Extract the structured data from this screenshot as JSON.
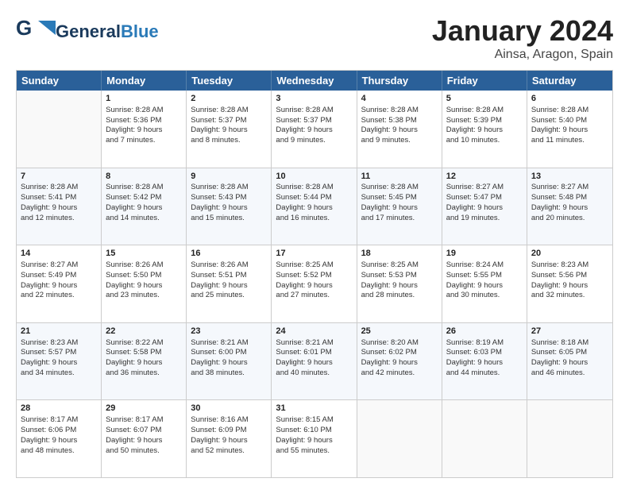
{
  "header": {
    "logo_line1": "General",
    "logo_line2": "Blue",
    "title": "January 2024",
    "subtitle": "Ainsa, Aragon, Spain"
  },
  "calendar": {
    "days": [
      "Sunday",
      "Monday",
      "Tuesday",
      "Wednesday",
      "Thursday",
      "Friday",
      "Saturday"
    ],
    "rows": [
      [
        {
          "num": "",
          "lines": []
        },
        {
          "num": "1",
          "lines": [
            "Sunrise: 8:28 AM",
            "Sunset: 5:36 PM",
            "Daylight: 9 hours",
            "and 7 minutes."
          ]
        },
        {
          "num": "2",
          "lines": [
            "Sunrise: 8:28 AM",
            "Sunset: 5:37 PM",
            "Daylight: 9 hours",
            "and 8 minutes."
          ]
        },
        {
          "num": "3",
          "lines": [
            "Sunrise: 8:28 AM",
            "Sunset: 5:37 PM",
            "Daylight: 9 hours",
            "and 9 minutes."
          ]
        },
        {
          "num": "4",
          "lines": [
            "Sunrise: 8:28 AM",
            "Sunset: 5:38 PM",
            "Daylight: 9 hours",
            "and 9 minutes."
          ]
        },
        {
          "num": "5",
          "lines": [
            "Sunrise: 8:28 AM",
            "Sunset: 5:39 PM",
            "Daylight: 9 hours",
            "and 10 minutes."
          ]
        },
        {
          "num": "6",
          "lines": [
            "Sunrise: 8:28 AM",
            "Sunset: 5:40 PM",
            "Daylight: 9 hours",
            "and 11 minutes."
          ]
        }
      ],
      [
        {
          "num": "7",
          "lines": [
            "Sunrise: 8:28 AM",
            "Sunset: 5:41 PM",
            "Daylight: 9 hours",
            "and 12 minutes."
          ]
        },
        {
          "num": "8",
          "lines": [
            "Sunrise: 8:28 AM",
            "Sunset: 5:42 PM",
            "Daylight: 9 hours",
            "and 14 minutes."
          ]
        },
        {
          "num": "9",
          "lines": [
            "Sunrise: 8:28 AM",
            "Sunset: 5:43 PM",
            "Daylight: 9 hours",
            "and 15 minutes."
          ]
        },
        {
          "num": "10",
          "lines": [
            "Sunrise: 8:28 AM",
            "Sunset: 5:44 PM",
            "Daylight: 9 hours",
            "and 16 minutes."
          ]
        },
        {
          "num": "11",
          "lines": [
            "Sunrise: 8:28 AM",
            "Sunset: 5:45 PM",
            "Daylight: 9 hours",
            "and 17 minutes."
          ]
        },
        {
          "num": "12",
          "lines": [
            "Sunrise: 8:27 AM",
            "Sunset: 5:47 PM",
            "Daylight: 9 hours",
            "and 19 minutes."
          ]
        },
        {
          "num": "13",
          "lines": [
            "Sunrise: 8:27 AM",
            "Sunset: 5:48 PM",
            "Daylight: 9 hours",
            "and 20 minutes."
          ]
        }
      ],
      [
        {
          "num": "14",
          "lines": [
            "Sunrise: 8:27 AM",
            "Sunset: 5:49 PM",
            "Daylight: 9 hours",
            "and 22 minutes."
          ]
        },
        {
          "num": "15",
          "lines": [
            "Sunrise: 8:26 AM",
            "Sunset: 5:50 PM",
            "Daylight: 9 hours",
            "and 23 minutes."
          ]
        },
        {
          "num": "16",
          "lines": [
            "Sunrise: 8:26 AM",
            "Sunset: 5:51 PM",
            "Daylight: 9 hours",
            "and 25 minutes."
          ]
        },
        {
          "num": "17",
          "lines": [
            "Sunrise: 8:25 AM",
            "Sunset: 5:52 PM",
            "Daylight: 9 hours",
            "and 27 minutes."
          ]
        },
        {
          "num": "18",
          "lines": [
            "Sunrise: 8:25 AM",
            "Sunset: 5:53 PM",
            "Daylight: 9 hours",
            "and 28 minutes."
          ]
        },
        {
          "num": "19",
          "lines": [
            "Sunrise: 8:24 AM",
            "Sunset: 5:55 PM",
            "Daylight: 9 hours",
            "and 30 minutes."
          ]
        },
        {
          "num": "20",
          "lines": [
            "Sunrise: 8:23 AM",
            "Sunset: 5:56 PM",
            "Daylight: 9 hours",
            "and 32 minutes."
          ]
        }
      ],
      [
        {
          "num": "21",
          "lines": [
            "Sunrise: 8:23 AM",
            "Sunset: 5:57 PM",
            "Daylight: 9 hours",
            "and 34 minutes."
          ]
        },
        {
          "num": "22",
          "lines": [
            "Sunrise: 8:22 AM",
            "Sunset: 5:58 PM",
            "Daylight: 9 hours",
            "and 36 minutes."
          ]
        },
        {
          "num": "23",
          "lines": [
            "Sunrise: 8:21 AM",
            "Sunset: 6:00 PM",
            "Daylight: 9 hours",
            "and 38 minutes."
          ]
        },
        {
          "num": "24",
          "lines": [
            "Sunrise: 8:21 AM",
            "Sunset: 6:01 PM",
            "Daylight: 9 hours",
            "and 40 minutes."
          ]
        },
        {
          "num": "25",
          "lines": [
            "Sunrise: 8:20 AM",
            "Sunset: 6:02 PM",
            "Daylight: 9 hours",
            "and 42 minutes."
          ]
        },
        {
          "num": "26",
          "lines": [
            "Sunrise: 8:19 AM",
            "Sunset: 6:03 PM",
            "Daylight: 9 hours",
            "and 44 minutes."
          ]
        },
        {
          "num": "27",
          "lines": [
            "Sunrise: 8:18 AM",
            "Sunset: 6:05 PM",
            "Daylight: 9 hours",
            "and 46 minutes."
          ]
        }
      ],
      [
        {
          "num": "28",
          "lines": [
            "Sunrise: 8:17 AM",
            "Sunset: 6:06 PM",
            "Daylight: 9 hours",
            "and 48 minutes."
          ]
        },
        {
          "num": "29",
          "lines": [
            "Sunrise: 8:17 AM",
            "Sunset: 6:07 PM",
            "Daylight: 9 hours",
            "and 50 minutes."
          ]
        },
        {
          "num": "30",
          "lines": [
            "Sunrise: 8:16 AM",
            "Sunset: 6:09 PM",
            "Daylight: 9 hours",
            "and 52 minutes."
          ]
        },
        {
          "num": "31",
          "lines": [
            "Sunrise: 8:15 AM",
            "Sunset: 6:10 PM",
            "Daylight: 9 hours",
            "and 55 minutes."
          ]
        },
        {
          "num": "",
          "lines": []
        },
        {
          "num": "",
          "lines": []
        },
        {
          "num": "",
          "lines": []
        }
      ]
    ]
  }
}
